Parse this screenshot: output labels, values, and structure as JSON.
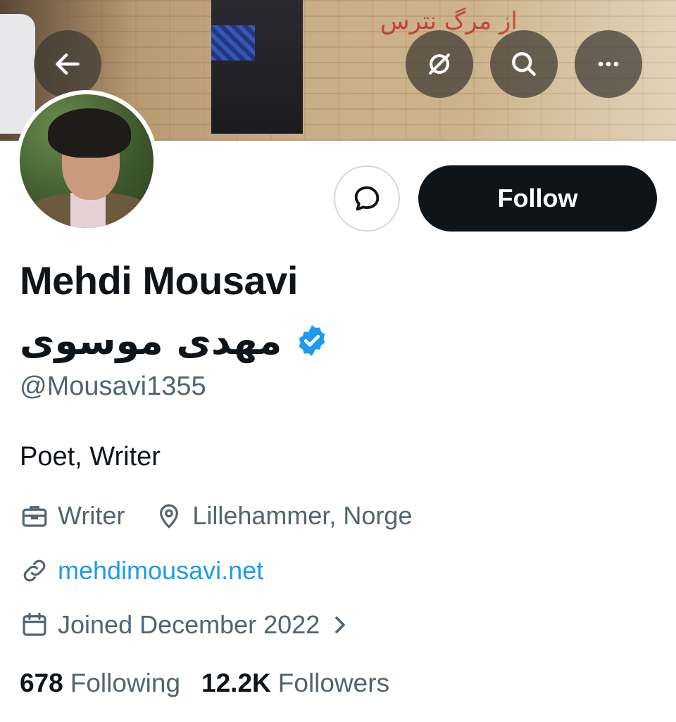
{
  "header": {
    "back_icon": "arrow-left-icon",
    "mute_icon": "eye-off-icon",
    "search_icon": "search-icon",
    "more_icon": "more-horizontal-icon",
    "banner_graffiti": "از مرگ نترس"
  },
  "profile": {
    "name_en": "Mehdi Mousavi",
    "name_fa": "مهدی موسوی",
    "verified_icon": "verified-badge-icon",
    "handle": "@Mousavi1355",
    "bio": "Poet, Writer",
    "profession_icon": "briefcase-icon",
    "profession": "Writer",
    "location_icon": "location-pin-icon",
    "location": "Lillehammer, Norge",
    "link_icon": "link-icon",
    "website": "mehdimousavi.net",
    "joined_icon": "calendar-icon",
    "joined": "Joined December 2022",
    "joined_chevron_icon": "chevron-right-icon"
  },
  "actions": {
    "message_icon": "message-bubble-icon",
    "follow_label": "Follow"
  },
  "stats": {
    "following_count": "678",
    "following_label": "Following",
    "followers_count": "12.2K",
    "followers_label": "Followers"
  },
  "colors": {
    "accent_blue": "#1d9bf0",
    "text_primary": "#0f1419",
    "text_secondary": "#536471",
    "follow_button_bg": "#0f1419"
  }
}
